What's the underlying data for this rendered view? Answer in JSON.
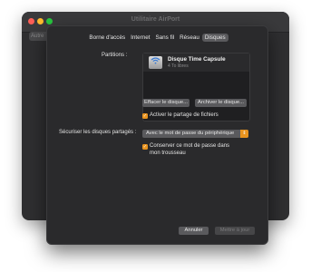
{
  "window": {
    "title": "Utilitaire AirPort"
  },
  "sidebar": {
    "partial_button": "Autre"
  },
  "tabs": [
    {
      "label": "Borne d'accès",
      "active": false
    },
    {
      "label": "Internet",
      "active": false
    },
    {
      "label": "Sans fil",
      "active": false
    },
    {
      "label": "Réseau",
      "active": false
    },
    {
      "label": "Disques",
      "active": true
    }
  ],
  "partitions": {
    "label": "Partitions :",
    "items": [
      {
        "name": "Disque Time Capsule",
        "subtitle": "4 To libres"
      }
    ]
  },
  "buttons": {
    "erase": "Effacer le disque...",
    "archive": "Archiver le disque...",
    "cancel": "Annuler",
    "update": "Mettre à jour"
  },
  "file_sharing": {
    "label": "Activer le partage de fichiers",
    "checked": true
  },
  "secure_disks": {
    "label": "Sécuriser les disques partagés :",
    "value": "Avec le mot de passe du périphérique"
  },
  "keychain": {
    "line1": "Conserver ce mot de passe dans",
    "line2": "mon trousseau",
    "checked": true
  },
  "colors": {
    "accent": "#e8931e",
    "sheet_bg": "#2a2a2c"
  }
}
